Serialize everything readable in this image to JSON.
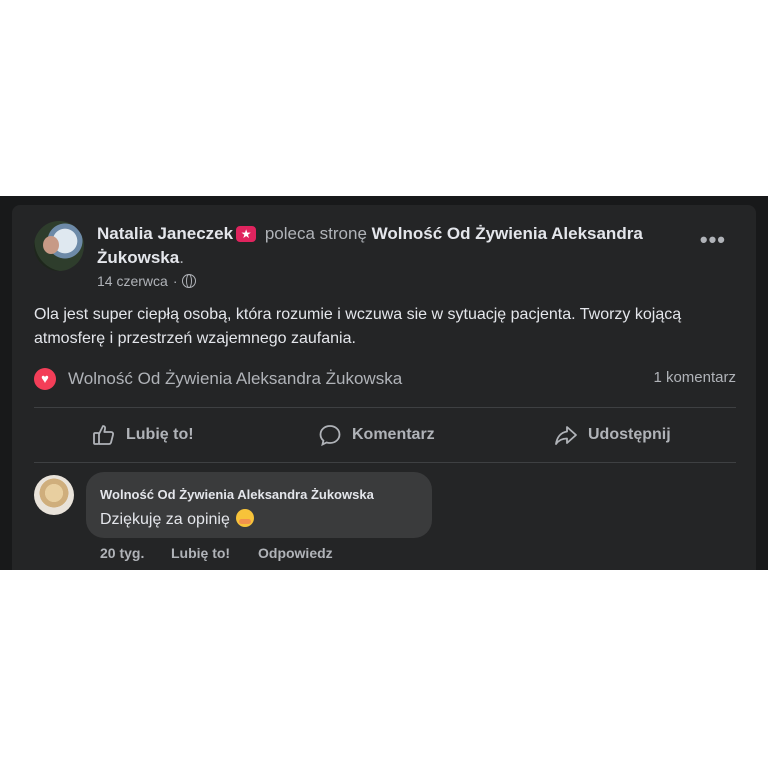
{
  "post": {
    "author": "Natalia Janeczek",
    "badge_icon": "star-recommend-icon",
    "verb": "poleca stronę",
    "page": "Wolność Od Żywienia Aleksandra Żukowska",
    "period": ".",
    "date": "14 czerwca",
    "separator": "·",
    "privacy_icon": "globe-icon",
    "more_label": "•••",
    "text": "Ola jest super ciepłą osobą, która rozumie i wczuwa sie w sytuację pacjenta. Tworzy kojącą atmosferę i przestrzeń wzajemnego zaufania.",
    "recommendation": {
      "icon": "heart-icon",
      "page": "Wolność Od Żywienia Aleksandra Żukowska",
      "comment_count": "1 komentarz"
    },
    "actions": {
      "like": "Lubię to!",
      "comment": "Komentarz",
      "share": "Udostępnij"
    }
  },
  "comment": {
    "author": "Wolność Od Żywienia Aleksandra Żukowska",
    "text": "Dziękuję za opinię",
    "emoji": "hugging-face-emoji",
    "time": "20 tyg.",
    "like": "Lubię to!",
    "reply": "Odpowiedz"
  },
  "colors": {
    "background": "#18191a",
    "card": "#242526",
    "bubble": "#3a3b3c",
    "text_primary": "#e4e6eb",
    "text_secondary": "#b0b3b8",
    "heart": "#f33e58",
    "badge": "#e0245e"
  }
}
